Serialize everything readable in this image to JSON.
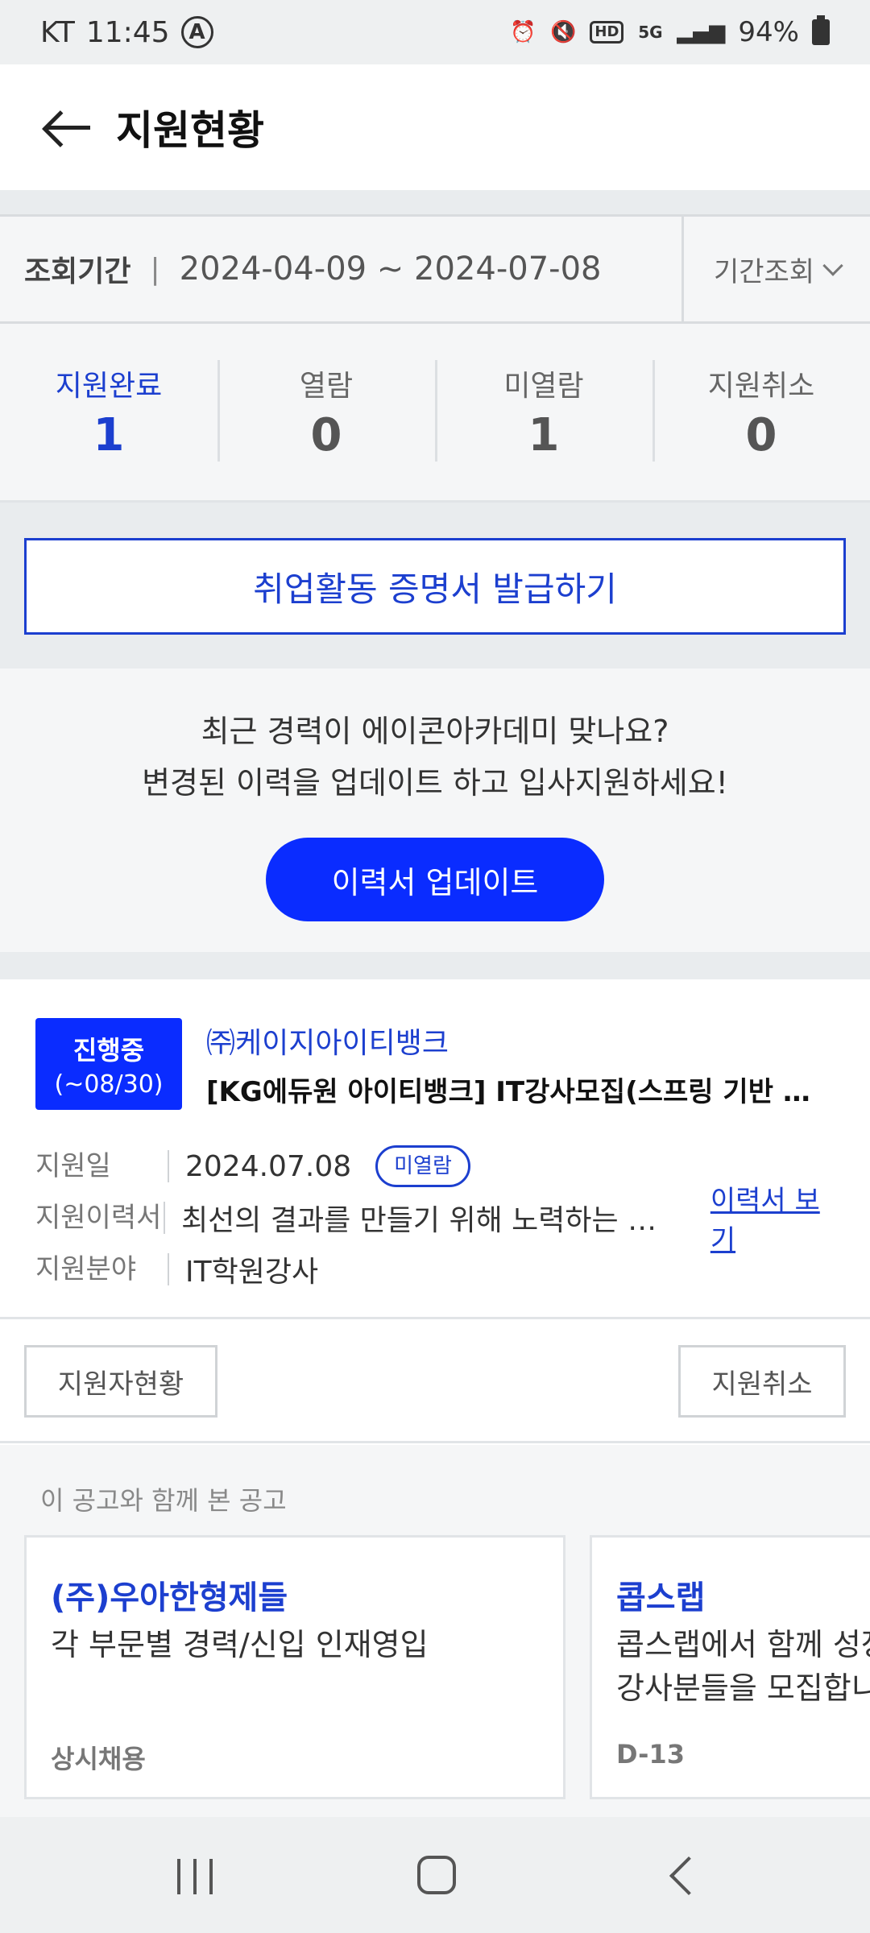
{
  "status_bar": {
    "carrier": "KT",
    "time": "11:45",
    "a_badge": "A",
    "network": "5G",
    "hd": "HD",
    "battery": "94%"
  },
  "header": {
    "title": "지원현황"
  },
  "period": {
    "label": "조회기간",
    "separator": "|",
    "range": "2024-04-09 ~ 2024-07-08",
    "button": "기간조회"
  },
  "stats": [
    {
      "label": "지원완료",
      "value": "1"
    },
    {
      "label": "열람",
      "value": "0"
    },
    {
      "label": "미열람",
      "value": "1"
    },
    {
      "label": "지원취소",
      "value": "0"
    }
  ],
  "certificate_button": "취업활동 증명서 발급하기",
  "promo": {
    "line1": "최근 경력이 에이콘아카데미 맞나요?",
    "line2": "변경된 이력을 업데이트 하고 입사지원하세요!",
    "button": "이력서 업데이트"
  },
  "application": {
    "status": "진행중",
    "deadline": "(~08/30)",
    "company": "㈜케이지아이티뱅크",
    "title": "[KG에듀원 아이티뱅크] IT강사모집(스프링 기반 개발 강의)",
    "rows": {
      "date_key": "지원일",
      "date_val": "2024.07.08",
      "read_status": "미열람",
      "resume_key": "지원이력서",
      "resume_val": "최선의 결과를 만들기 위해 노력하는 인재입니다",
      "resume_link": "이력서 보기",
      "field_key": "지원분야",
      "field_val": "IT학원강사"
    },
    "applicants_button": "지원자현황",
    "cancel_button": "지원취소"
  },
  "related": {
    "title": "이 공고와 함께 본 공고",
    "cards": [
      {
        "company": "(주)우아한형제들",
        "desc1": "각 부문별 경력/신입 인재영입",
        "desc2": "",
        "tag": "상시채용"
      },
      {
        "company": "콥스랩",
        "desc1": "콥스랩에서 함께 성장할",
        "desc2": "강사분들을 모집합니다",
        "tag": "D-13"
      }
    ]
  },
  "colors": {
    "accent": "#1c3fcf",
    "primary_button": "#0a2cff",
    "background": "#f5f6f7"
  }
}
